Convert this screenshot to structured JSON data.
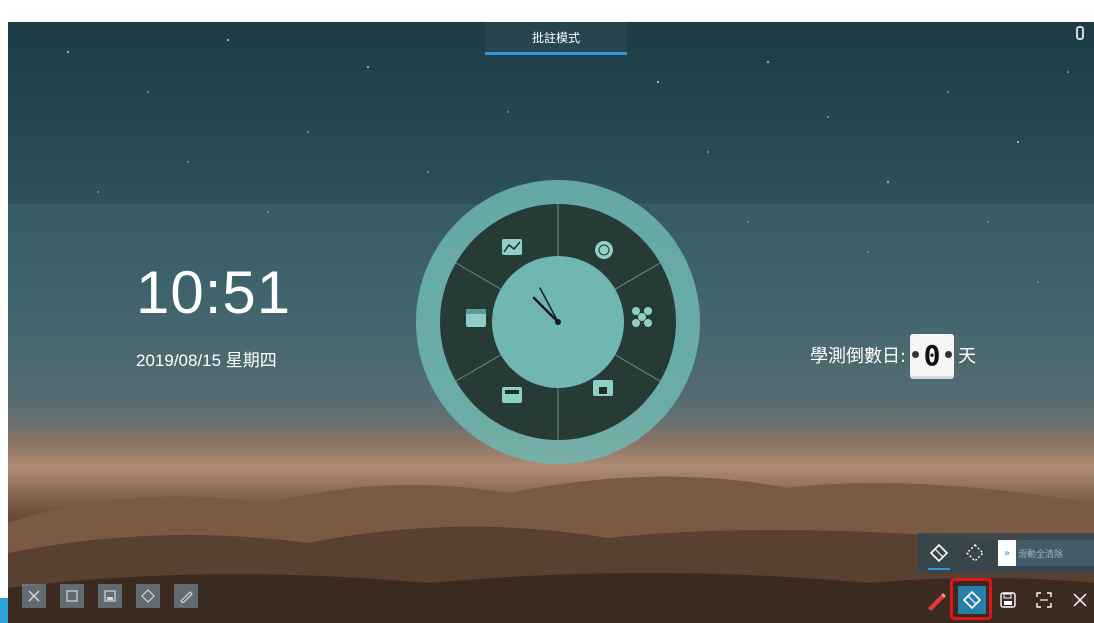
{
  "mode_tab": {
    "label": "批註模式"
  },
  "clock": {
    "time": "10:51",
    "date": "2019/08/15  星期四"
  },
  "countdown": {
    "label": "學測倒數日:",
    "digit": "0",
    "unit": "天"
  },
  "dial": {
    "segments": [
      "chart-icon",
      "globe-icon",
      "fan-icon",
      "cast-icon",
      "calculator-icon",
      "calendar-icon"
    ]
  },
  "eraser_panel": {
    "tools": [
      "eraser-icon",
      "region-eraser-icon"
    ],
    "clear_label": "滑動全清除",
    "clear_arrow": "»"
  },
  "bottom_toolbar": {
    "tools": [
      "pen-icon",
      "eraser-icon",
      "save-icon",
      "selection-icon",
      "close-icon"
    ],
    "pen_color": "#e23a3a",
    "highlight_color": "#e0141c"
  },
  "left_toolbar": {
    "tools": [
      "close-icon",
      "selection-icon",
      "save-icon",
      "eraser-icon",
      "pen-icon"
    ]
  }
}
